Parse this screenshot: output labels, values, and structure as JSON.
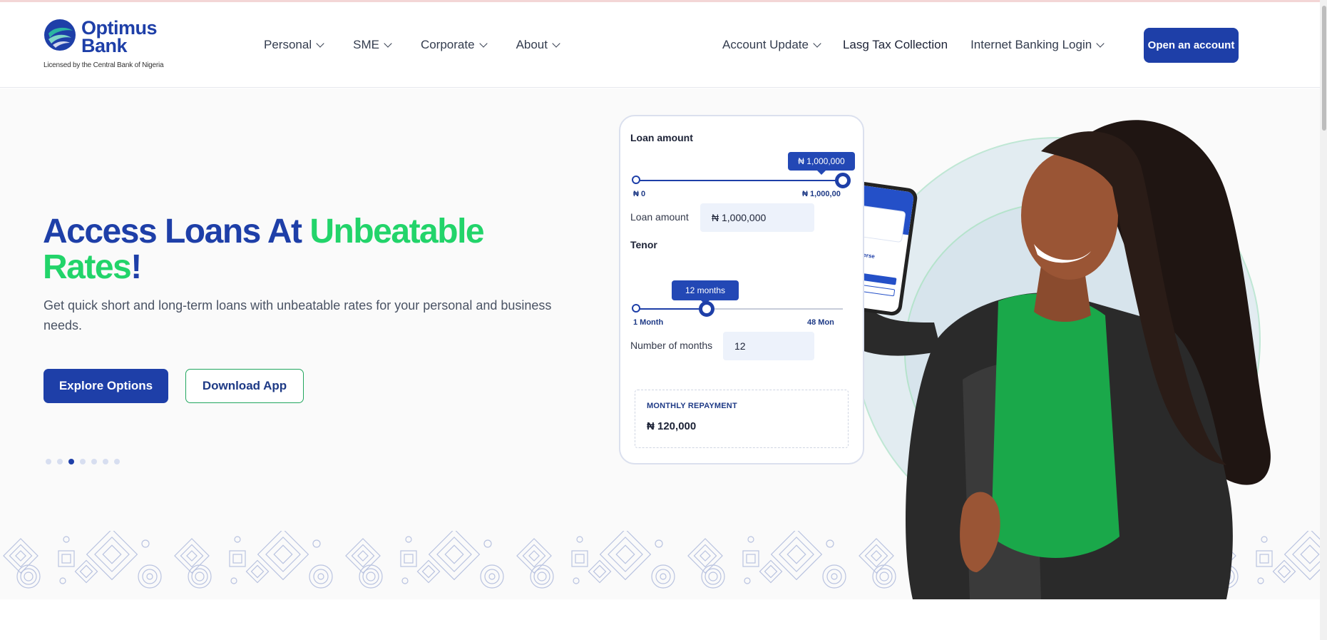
{
  "brand": {
    "name_line1": "Optimus",
    "name_line2": "Bank",
    "tagline": "Licensed by the Central Bank of Nigeria",
    "primary_color": "#1e3fa8",
    "accent_color": "#22d46a"
  },
  "nav": {
    "left": [
      {
        "label": "Personal"
      },
      {
        "label": "SME"
      },
      {
        "label": "Corporate"
      },
      {
        "label": "About"
      }
    ],
    "account_update": "Account Update",
    "lasg_tax": "Lasg Tax Collection",
    "internet_banking": "Internet Banking Login",
    "open_account": "Open an account"
  },
  "hero": {
    "title_part1": "Access Loans At ",
    "title_part2": "Unbeatable",
    "title_part3": "Rates",
    "title_part4": "!",
    "subtitle": "Get quick short and long-term loans with unbeatable rates for your personal and business needs.",
    "explore_button": "Explore Options",
    "download_button": "Download App",
    "slide_count": 7,
    "active_slide": 3
  },
  "calculator": {
    "loan_amount_heading": "Loan amount",
    "loan_amount_tooltip": "₦ 1,000,000",
    "loan_min_label": "₦ 0",
    "loan_max_label": "₦ 1,000,00",
    "loan_slider_fraction": 1.0,
    "loan_amount_field_label": "Loan amount",
    "loan_amount_value": "₦ 1,000,000",
    "tenor_heading": "Tenor",
    "tenor_tooltip": "12 months",
    "tenor_min_label": "1 Month",
    "tenor_max_label": "48 Mon",
    "tenor_slider_fraction": 0.34,
    "months_field_label": "Number of months",
    "months_value": "12",
    "repayment_title": "MONTHLY REPAYMENT",
    "repayment_value": "₦ 120,000"
  },
  "phone_app": {
    "brand": "OptiVerse"
  }
}
